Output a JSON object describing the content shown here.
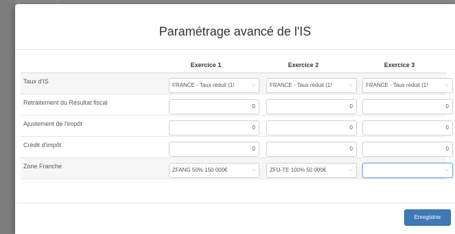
{
  "modal": {
    "title": "Paramétrage avancé de l'IS",
    "save_label": "Enregistrer"
  },
  "table": {
    "columns": [
      "Exercice 1",
      "Exercice 2",
      "Exercice 3"
    ],
    "rows": [
      {
        "label": "Taux d'IS",
        "type": "select",
        "values": [
          "FRANCE - Taux réduit (1!",
          "FRANCE - Taux réduit (1!",
          "FRANCE - Taux réduit (1!"
        ]
      },
      {
        "label": "Retraitement du Résultat fiscal",
        "type": "number",
        "values": [
          "0",
          "0",
          "0"
        ]
      },
      {
        "label": "Ajustement de l'impôt",
        "type": "number",
        "values": [
          "0",
          "0",
          "0"
        ]
      },
      {
        "label": "Crédit d'impôt",
        "type": "number",
        "values": [
          "0",
          "0",
          "0"
        ]
      },
      {
        "label": "Zone Franche",
        "type": "select",
        "values": [
          "ZFANG 50% 150 000€",
          "ZFU-TE 100% 50 000€",
          ""
        ]
      }
    ]
  },
  "icons": {
    "select_chevron": "chevron-down-icon"
  },
  "colors": {
    "primary": "#3e79b5",
    "focus": "#7fb2e5"
  }
}
